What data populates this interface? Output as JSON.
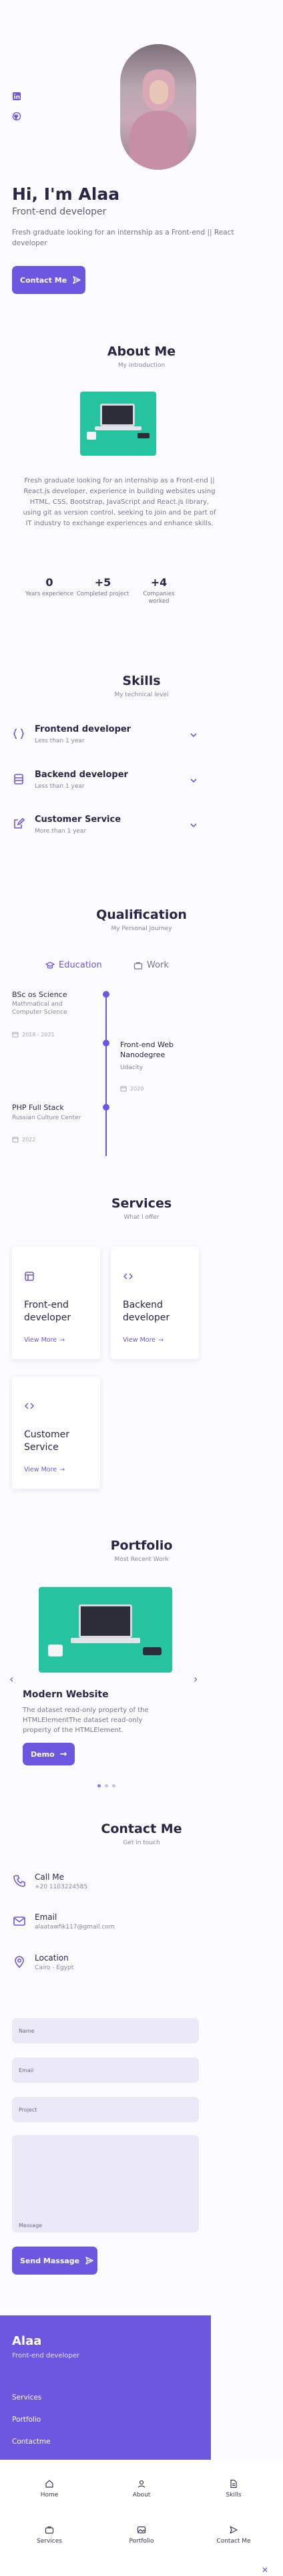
{
  "hero": {
    "title": "Hi, I'm Alaa",
    "subtitle": "Front-end developer",
    "description": "Fresh graduate looking for an internship as a Front-end || React developer",
    "contact_button": "Contact Me"
  },
  "social": [
    {
      "icon": "linkedin-icon"
    },
    {
      "icon": "github-icon"
    }
  ],
  "about": {
    "title": "About Me",
    "subtitle": "My introduction",
    "text": "Fresh graduate looking for an internship as a Front-end || React.js developer, experience in building websites using HTML, CSS, Bootstrap, JavaScript and React.js library, using git as version control, seeking to join and be part of IT industry to exchange experiences and enhance skills.",
    "stats": [
      {
        "num": "0",
        "label": "Years experience"
      },
      {
        "num": "+5",
        "label": "Completed project"
      },
      {
        "num": "+4",
        "label": "Companies worked"
      }
    ]
  },
  "skills": {
    "title": "Skills",
    "subtitle": "My technical level",
    "items": [
      {
        "title": "Frontend developer",
        "sub": "Less than 1 year",
        "icon": "brackets-icon"
      },
      {
        "title": "Backend developer",
        "sub": "Less than 1 year",
        "icon": "server-icon"
      },
      {
        "title": "Customer Service",
        "sub": "More than 1 year",
        "icon": "edit-icon"
      }
    ]
  },
  "qualification": {
    "title": "Qualification",
    "subtitle": "My Personal Journey",
    "tabs": [
      "Education",
      "Work"
    ],
    "items": [
      {
        "title": "BSc os Science",
        "sub": "Mathmatical and Computer Science",
        "date": "2018 - 2021"
      },
      {
        "title": "Front-end Web Nanodegree",
        "sub": "Udacity",
        "date": "2020"
      },
      {
        "title": "PHP Full Stack",
        "sub": "Russian Culture Center",
        "date": "2022"
      }
    ]
  },
  "services": {
    "title": "Services",
    "subtitle": "What I offer",
    "items": [
      {
        "title": "Front-end developer",
        "view_more": "View More",
        "icon": "layout-icon"
      },
      {
        "title": "Backend developer",
        "view_more": "View More",
        "icon": "code-icon"
      },
      {
        "title": "Customer Service",
        "view_more": "View More",
        "icon": "code-icon"
      }
    ]
  },
  "portfolio": {
    "title": "Portfolio",
    "subtitle": "Most Recent Work",
    "item_title": "Modern Website",
    "item_desc": "The dataset read-only property of the HTMLElementThe dataset read-only property of the HTMLElement.",
    "demo_button": "Demo"
  },
  "contact": {
    "title": "Contact Me",
    "subtitle": "Get in touch",
    "items": [
      {
        "title": "Call Me",
        "sub": "+20 1103224585",
        "icon": "phone-icon"
      },
      {
        "title": "Email",
        "sub": "alaatawfik117@gmail.com",
        "icon": "mail-icon"
      },
      {
        "title": "Location",
        "sub": "Cairo - Egypt",
        "icon": "location-icon"
      }
    ],
    "fields": {
      "name": "Name",
      "email": "Email",
      "project": "Project",
      "message": "Message"
    },
    "send_button": "Send Massage"
  },
  "footer": {
    "brand": "Alaa",
    "tagline": "Front-end developer",
    "links": [
      "Services",
      "Portfolio",
      "Contactme"
    ]
  },
  "nav": {
    "items": [
      {
        "label": "Home",
        "icon": "home-icon"
      },
      {
        "label": "About",
        "icon": "user-icon"
      },
      {
        "label": "Skills",
        "icon": "file-icon"
      },
      {
        "label": "Services",
        "icon": "briefcase-icon"
      },
      {
        "label": "Portfolio",
        "icon": "image-icon"
      },
      {
        "label": "Contact Me",
        "icon": "send-icon"
      }
    ]
  },
  "colors": {
    "accent": "#6e57e0",
    "image_bg": "#25c3a0",
    "text": "#2b2546"
  }
}
